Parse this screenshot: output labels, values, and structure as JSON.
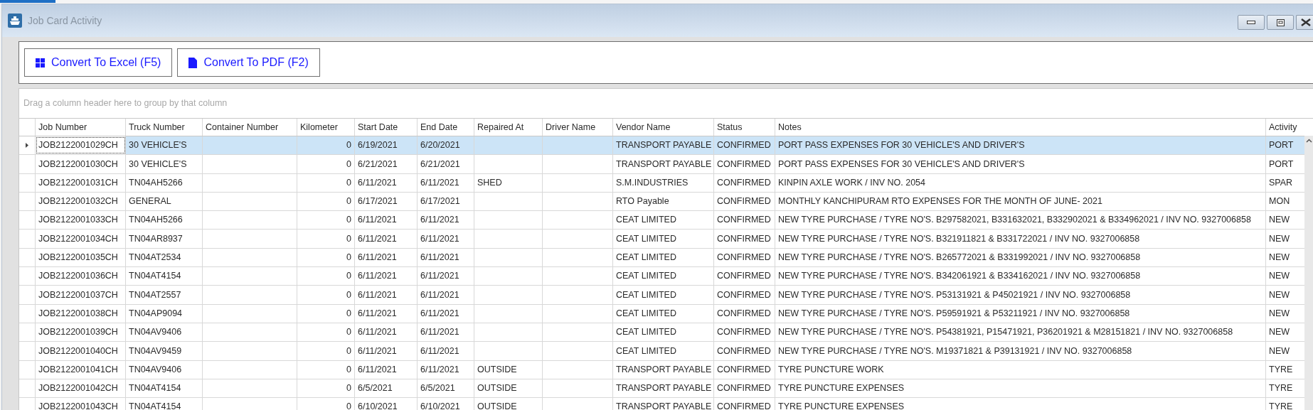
{
  "window": {
    "title": "Job Card Activity"
  },
  "toolbar": {
    "buttons": [
      {
        "label": "Convert To Excel (F5)",
        "kind": "excel"
      },
      {
        "label": "Convert To PDF (F2)",
        "kind": "pdf"
      }
    ]
  },
  "grid": {
    "group_panel_hint": "Drag a column header here to group by that column",
    "columns": [
      "Job Number",
      "Truck Number",
      "Container Number",
      "Kilometer",
      "Start Date",
      "End Date",
      "Repaired At",
      "Driver Name",
      "Vendor Name",
      "Status",
      "Notes",
      "Activity"
    ],
    "rows": [
      {
        "selected": true,
        "job": "JOB2122001029CH",
        "truck": "30 VEHICLE'S",
        "km": "0",
        "start": "6/19/2021",
        "end": "6/20/2021",
        "vendor": "TRANSPORT PAYABLE",
        "status": "CONFIRMED",
        "notes": "PORT PASS EXPENSES FOR 30 VEHICLE'S AND DRIVER'S",
        "activity": "PORT"
      },
      {
        "selected": false,
        "job": "JOB2122001030CH",
        "truck": "30 VEHICLE'S",
        "km": "0",
        "start": "6/21/2021",
        "end": "6/21/2021",
        "vendor": "TRANSPORT PAYABLE",
        "status": "CONFIRMED",
        "notes": "PORT PASS EXPENSES FOR 30 VEHICLE'S AND DRIVER'S",
        "activity": "PORT"
      },
      {
        "selected": false,
        "job": "JOB2122001031CH",
        "truck": "TN04AH5266",
        "km": "0",
        "start": "6/11/2021",
        "end": "6/11/2021",
        "repaired": "SHED",
        "vendor": "S.M.INDUSTRIES",
        "status": "CONFIRMED",
        "notes": "KINPIN AXLE WORK / INV NO. 2054",
        "activity": "SPAR"
      },
      {
        "selected": false,
        "job": "JOB2122001032CH",
        "truck": "GENERAL",
        "km": "0",
        "start": "6/17/2021",
        "end": "6/17/2021",
        "vendor": "RTO Payable",
        "status": "CONFIRMED",
        "notes": "MONTHLY KANCHIPURAM RTO EXPENSES FOR THE MONTH OF JUNE- 2021",
        "activity": "MON"
      },
      {
        "selected": false,
        "job": "JOB2122001033CH",
        "truck": "TN04AH5266",
        "km": "0",
        "start": "6/11/2021",
        "end": "6/11/2021",
        "vendor": "CEAT LIMITED",
        "status": "CONFIRMED",
        "notes": "NEW TYRE PURCHASE / TYRE NO'S. B297582021, B331632021, B332902021 & B334962021 / INV NO. 9327006858",
        "activity": "NEW"
      },
      {
        "selected": false,
        "job": "JOB2122001034CH",
        "truck": "TN04AR8937",
        "km": "0",
        "start": "6/11/2021",
        "end": "6/11/2021",
        "vendor": "CEAT LIMITED",
        "status": "CONFIRMED",
        "notes": "NEW TYRE PURCHASE / TYRE NO'S. B321911821 & B331722021 / INV NO. 9327006858",
        "activity": "NEW"
      },
      {
        "selected": false,
        "job": "JOB2122001035CH",
        "truck": "TN04AT2534",
        "km": "0",
        "start": "6/11/2021",
        "end": "6/11/2021",
        "vendor": "CEAT LIMITED",
        "status": "CONFIRMED",
        "notes": "NEW TYRE PURCHASE / TYRE NO'S. B265772021 & B331992021 / INV NO. 9327006858",
        "activity": "NEW"
      },
      {
        "selected": false,
        "job": "JOB2122001036CH",
        "truck": "TN04AT4154",
        "km": "0",
        "start": "6/11/2021",
        "end": "6/11/2021",
        "vendor": "CEAT LIMITED",
        "status": "CONFIRMED",
        "notes": "NEW TYRE PURCHASE / TYRE NO'S. B342061921 & B334162021 / INV NO. 9327006858",
        "activity": "NEW"
      },
      {
        "selected": false,
        "job": "JOB2122001037CH",
        "truck": "TN04AT2557",
        "km": "0",
        "start": "6/11/2021",
        "end": "6/11/2021",
        "vendor": "CEAT LIMITED",
        "status": "CONFIRMED",
        "notes": "NEW TYRE PURCHASE / TYRE NO'S. P53131921 & P45021921 / INV NO. 9327006858",
        "activity": "NEW"
      },
      {
        "selected": false,
        "job": "JOB2122001038CH",
        "truck": "TN04AP9094",
        "km": "0",
        "start": "6/11/2021",
        "end": "6/11/2021",
        "vendor": "CEAT LIMITED",
        "status": "CONFIRMED",
        "notes": "NEW TYRE PURCHASE / TYRE NO'S. P59591921 & P53211921 / INV NO. 9327006858",
        "activity": "NEW"
      },
      {
        "selected": false,
        "job": "JOB2122001039CH",
        "truck": "TN04AV9406",
        "km": "0",
        "start": "6/11/2021",
        "end": "6/11/2021",
        "vendor": "CEAT LIMITED",
        "status": "CONFIRMED",
        "notes": "NEW TYRE PURCHASE / TYRE NO'S. P54381921, P15471921, P36201921 & M28151821 / INV NO. 9327006858",
        "activity": "NEW"
      },
      {
        "selected": false,
        "job": "JOB2122001040CH",
        "truck": "TN04AV9459",
        "km": "0",
        "start": "6/11/2021",
        "end": "6/11/2021",
        "vendor": "CEAT LIMITED",
        "status": "CONFIRMED",
        "notes": "NEW TYRE PURCHASE / TYRE NO'S. M19371821 & P39131921 / INV NO. 9327006858",
        "activity": "NEW"
      },
      {
        "selected": false,
        "job": "JOB2122001041CH",
        "truck": "TN04AV9406",
        "km": "0",
        "start": "6/11/2021",
        "end": "6/11/2021",
        "repaired": "OUTSIDE",
        "vendor": "TRANSPORT PAYABLE",
        "status": "CONFIRMED",
        "notes": "TYRE PUNCTURE WORK",
        "activity": "TYRE"
      },
      {
        "selected": false,
        "job": "JOB2122001042CH",
        "truck": "TN04AT4154",
        "km": "0",
        "start": "6/5/2021",
        "end": "6/5/2021",
        "repaired": "OUTSIDE",
        "vendor": "TRANSPORT PAYABLE",
        "status": "CONFIRMED",
        "notes": "TYRE PUNCTURE EXPENSES",
        "activity": "TYRE"
      },
      {
        "selected": false,
        "job": "JOB2122001043CH",
        "truck": "TN04AT4154",
        "km": "0",
        "start": "6/10/2021",
        "end": "6/10/2021",
        "repaired": "OUTSIDE",
        "vendor": "TRANSPORT PAYABLE",
        "status": "CONFIRMED",
        "notes": "TYRE PUNCTURE EXPENSES",
        "activity": "TYRE"
      }
    ]
  }
}
